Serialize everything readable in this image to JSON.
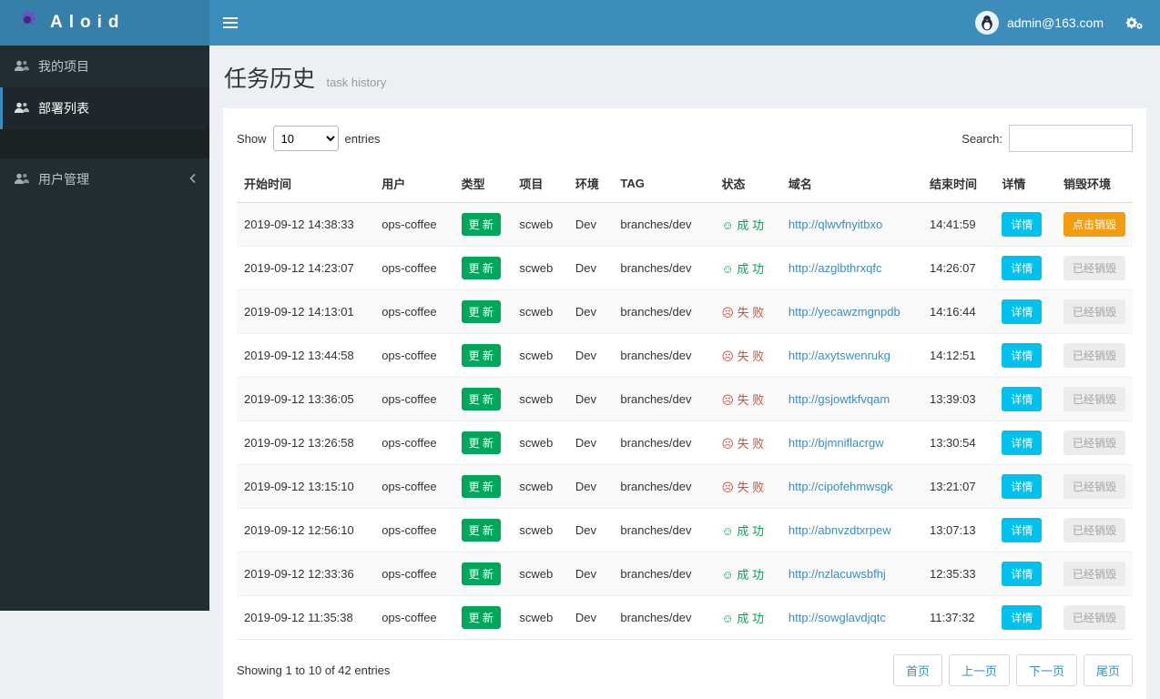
{
  "topbar": {
    "brand": "Aloid",
    "user_email": "admin@163.com"
  },
  "sidebar": {
    "items": [
      {
        "label": "我的项目"
      },
      {
        "label": "部署列表"
      },
      {
        "label": "用户管理"
      }
    ]
  },
  "page": {
    "title": "任务历史",
    "subtitle": "task history"
  },
  "controls": {
    "show_label": "Show",
    "page_size": "10",
    "entries_label": "entries",
    "search_label": "Search:"
  },
  "table": {
    "headers": [
      "开始时间",
      "用户",
      "类型",
      "项目",
      "环境",
      "TAG",
      "状态",
      "域名",
      "结束时间",
      "详情",
      "销毁环境"
    ],
    "rows": [
      {
        "start": "2019-09-12 14:38:33",
        "user": "ops-coffee",
        "type": "更 新",
        "project": "scweb",
        "env": "Dev",
        "tag": "branches/dev",
        "status_icon": "☺",
        "status_text": "成 功",
        "status_state": "success",
        "domain": "http://qlwvfnyitbxo",
        "end": "14:41:59",
        "detail": "详情",
        "destroy_text": "点击销毁",
        "destroy_state": "active"
      },
      {
        "start": "2019-09-12 14:23:07",
        "user": "ops-coffee",
        "type": "更 新",
        "project": "scweb",
        "env": "Dev",
        "tag": "branches/dev",
        "status_icon": "☺",
        "status_text": "成 功",
        "status_state": "success",
        "domain": "http://azglbthrxqfc",
        "end": "14:26:07",
        "detail": "详情",
        "destroy_text": "已经销毁",
        "destroy_state": "done"
      },
      {
        "start": "2019-09-12 14:13:01",
        "user": "ops-coffee",
        "type": "更 新",
        "project": "scweb",
        "env": "Dev",
        "tag": "branches/dev",
        "status_icon": "☹",
        "status_text": "失 败",
        "status_state": "fail",
        "domain": "http://yecawzmgnpdb",
        "end": "14:16:44",
        "detail": "详情",
        "destroy_text": "已经销毁",
        "destroy_state": "done"
      },
      {
        "start": "2019-09-12 13:44:58",
        "user": "ops-coffee",
        "type": "更 新",
        "project": "scweb",
        "env": "Dev",
        "tag": "branches/dev",
        "status_icon": "☹",
        "status_text": "失 败",
        "status_state": "fail",
        "domain": "http://axytswenrukg",
        "end": "14:12:51",
        "detail": "详情",
        "destroy_text": "已经销毁",
        "destroy_state": "done"
      },
      {
        "start": "2019-09-12 13:36:05",
        "user": "ops-coffee",
        "type": "更 新",
        "project": "scweb",
        "env": "Dev",
        "tag": "branches/dev",
        "status_icon": "☹",
        "status_text": "失 败",
        "status_state": "fail",
        "domain": "http://gsjowtkfvqam",
        "end": "13:39:03",
        "detail": "详情",
        "destroy_text": "已经销毁",
        "destroy_state": "done"
      },
      {
        "start": "2019-09-12 13:26:58",
        "user": "ops-coffee",
        "type": "更 新",
        "project": "scweb",
        "env": "Dev",
        "tag": "branches/dev",
        "status_icon": "☹",
        "status_text": "失 败",
        "status_state": "fail",
        "domain": "http://bjmniflacrgw",
        "end": "13:30:54",
        "detail": "详情",
        "destroy_text": "已经销毁",
        "destroy_state": "done"
      },
      {
        "start": "2019-09-12 13:15:10",
        "user": "ops-coffee",
        "type": "更 新",
        "project": "scweb",
        "env": "Dev",
        "tag": "branches/dev",
        "status_icon": "☹",
        "status_text": "失 败",
        "status_state": "fail",
        "domain": "http://cipofehmwsgk",
        "end": "13:21:07",
        "detail": "详情",
        "destroy_text": "已经销毁",
        "destroy_state": "done"
      },
      {
        "start": "2019-09-12 12:56:10",
        "user": "ops-coffee",
        "type": "更 新",
        "project": "scweb",
        "env": "Dev",
        "tag": "branches/dev",
        "status_icon": "☺",
        "status_text": "成 功",
        "status_state": "success",
        "domain": "http://abnvzdtxrpew",
        "end": "13:07:13",
        "detail": "详情",
        "destroy_text": "已经销毁",
        "destroy_state": "done"
      },
      {
        "start": "2019-09-12 12:33:36",
        "user": "ops-coffee",
        "type": "更 新",
        "project": "scweb",
        "env": "Dev",
        "tag": "branches/dev",
        "status_icon": "☺",
        "status_text": "成 功",
        "status_state": "success",
        "domain": "http://nzlacuwsbfhj",
        "end": "12:35:33",
        "detail": "详情",
        "destroy_text": "已经销毁",
        "destroy_state": "done"
      },
      {
        "start": "2019-09-12 11:35:38",
        "user": "ops-coffee",
        "type": "更 新",
        "project": "scweb",
        "env": "Dev",
        "tag": "branches/dev",
        "status_icon": "☺",
        "status_text": "成 功",
        "status_state": "success",
        "domain": "http://sowglavdjqtc",
        "end": "11:37:32",
        "detail": "详情",
        "destroy_text": "已经销毁",
        "destroy_state": "done"
      }
    ]
  },
  "footer": {
    "summary": "Showing 1 to 10 of 42 entries",
    "pagination": [
      "首页",
      "上一页",
      "下一页",
      "尾页"
    ]
  }
}
